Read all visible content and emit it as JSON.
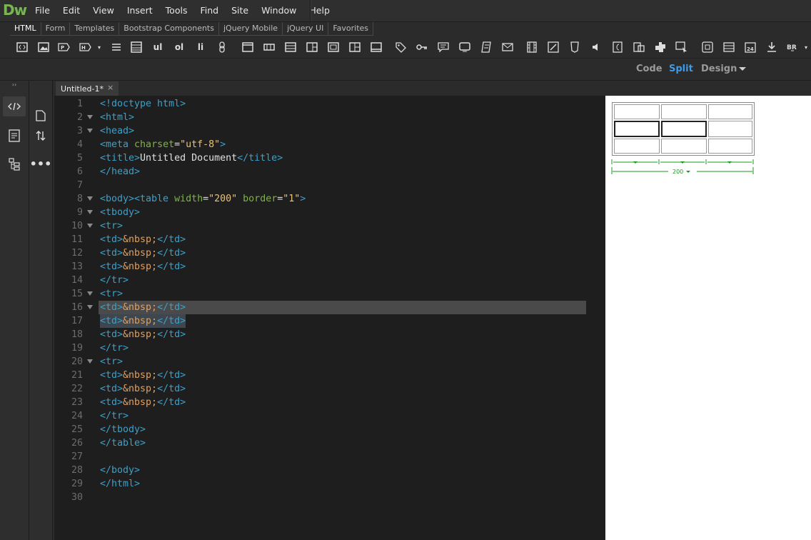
{
  "app": {
    "logo": "Dw"
  },
  "menu": [
    "File",
    "Edit",
    "View",
    "Insert",
    "Tools",
    "Find",
    "Site",
    "Window",
    "Help"
  ],
  "insert_tabs": [
    "HTML",
    "Form",
    "Templates",
    "Bootstrap Components",
    "jQuery Mobile",
    "jQuery UI",
    "Favorites"
  ],
  "toolbar": {
    "labels": {
      "ul": "ul",
      "ol": "ol",
      "li": "li"
    },
    "icons": [
      "div-icon",
      "image-icon",
      "paragraph-icon",
      "heading-icon",
      "list-icon",
      "table-icon",
      "ul-button",
      "ol-button",
      "li-button",
      "hyperlink-icon",
      "header-icon",
      "navigation-icon",
      "main-icon",
      "aside-icon",
      "article-icon",
      "section-icon",
      "footer-icon",
      "tag-icon",
      "key-icon",
      "comment-icon",
      "monitor-icon",
      "script-icon",
      "email-icon",
      "video-icon",
      "canvas-icon",
      "html5-icon",
      "audio-icon",
      "flash-icon",
      "plugin-icon",
      "rollover-image-icon",
      "iframe-icon",
      "horizontal-rule-icon",
      "date-icon",
      "download-icon",
      "character-icon"
    ]
  },
  "view": {
    "code": "Code",
    "split": "Split",
    "design": "Design",
    "active": "Split"
  },
  "document": {
    "tab_title": "Untitled-1*"
  },
  "code": {
    "lines": [
      {
        "n": "1",
        "segs": [
          [
            "t",
            "<!doctype html>"
          ]
        ]
      },
      {
        "n": "2",
        "fold": true,
        "segs": [
          [
            "t",
            "<html>"
          ]
        ]
      },
      {
        "n": "3",
        "fold": true,
        "segs": [
          [
            "t",
            "<head>"
          ]
        ]
      },
      {
        "n": "4",
        "segs": [
          [
            "t",
            "<meta "
          ],
          [
            "a",
            "charset"
          ],
          [
            "p",
            "="
          ],
          [
            "v",
            "\"utf-8\""
          ],
          [
            "t",
            ">"
          ]
        ]
      },
      {
        "n": "5",
        "segs": [
          [
            "t",
            "<title>"
          ],
          [
            "p",
            "Untitled Document"
          ],
          [
            "t",
            "</title>"
          ]
        ]
      },
      {
        "n": "6",
        "segs": [
          [
            "t",
            "</head>"
          ]
        ]
      },
      {
        "n": "7",
        "segs": []
      },
      {
        "n": "8",
        "fold": true,
        "segs": [
          [
            "t",
            "<body><table "
          ],
          [
            "a",
            "width"
          ],
          [
            "p",
            "="
          ],
          [
            "v",
            "\"200\""
          ],
          [
            "p",
            " "
          ],
          [
            "a",
            "border"
          ],
          [
            "p",
            "="
          ],
          [
            "v",
            "\"1\""
          ],
          [
            "t",
            ">"
          ]
        ]
      },
      {
        "n": "9",
        "fold": true,
        "segs": [
          [
            "t",
            "<tbody>"
          ]
        ]
      },
      {
        "n": "10",
        "fold": true,
        "segs": [
          [
            "t",
            "<tr>"
          ]
        ]
      },
      {
        "n": "11",
        "segs": [
          [
            "t",
            "<td>"
          ],
          [
            "e",
            "&nbsp;"
          ],
          [
            "t",
            "</td>"
          ]
        ]
      },
      {
        "n": "12",
        "segs": [
          [
            "t",
            "<td>"
          ],
          [
            "e",
            "&nbsp;"
          ],
          [
            "t",
            "</td>"
          ]
        ]
      },
      {
        "n": "13",
        "segs": [
          [
            "t",
            "<td>"
          ],
          [
            "e",
            "&nbsp;"
          ],
          [
            "t",
            "</td>"
          ]
        ]
      },
      {
        "n": "14",
        "segs": [
          [
            "t",
            "</tr>"
          ]
        ]
      },
      {
        "n": "15",
        "fold": true,
        "segs": [
          [
            "t",
            "<tr>"
          ]
        ]
      },
      {
        "n": "16",
        "fold": true,
        "hl": "row",
        "segs": [
          [
            "t",
            "<td>"
          ],
          [
            "e",
            "&nbsp;"
          ],
          [
            "t",
            "</td>"
          ]
        ]
      },
      {
        "n": "17",
        "hl": "sel",
        "segs": [
          [
            "t",
            "<td>"
          ],
          [
            "e",
            "&nbsp;"
          ],
          [
            "t",
            "</td>"
          ]
        ]
      },
      {
        "n": "18",
        "segs": [
          [
            "t",
            "<td>"
          ],
          [
            "e",
            "&nbsp;"
          ],
          [
            "t",
            "</td>"
          ]
        ]
      },
      {
        "n": "19",
        "segs": [
          [
            "t",
            "</tr>"
          ]
        ]
      },
      {
        "n": "20",
        "fold": true,
        "segs": [
          [
            "t",
            "<tr>"
          ]
        ]
      },
      {
        "n": "21",
        "segs": [
          [
            "t",
            "<td>"
          ],
          [
            "e",
            "&nbsp;"
          ],
          [
            "t",
            "</td>"
          ]
        ]
      },
      {
        "n": "22",
        "segs": [
          [
            "t",
            "<td>"
          ],
          [
            "e",
            "&nbsp;"
          ],
          [
            "t",
            "</td>"
          ]
        ]
      },
      {
        "n": "23",
        "segs": [
          [
            "t",
            "<td>"
          ],
          [
            "e",
            "&nbsp;"
          ],
          [
            "t",
            "</td>"
          ]
        ]
      },
      {
        "n": "24",
        "segs": [
          [
            "t",
            "</tr>"
          ]
        ]
      },
      {
        "n": "25",
        "segs": [
          [
            "t",
            "</tbody>"
          ]
        ]
      },
      {
        "n": "26",
        "segs": [
          [
            "t",
            "</table>"
          ]
        ]
      },
      {
        "n": "27",
        "segs": []
      },
      {
        "n": "28",
        "segs": [
          [
            "t",
            "</body>"
          ]
        ]
      },
      {
        "n": "29",
        "segs": [
          [
            "t",
            "</html>"
          ]
        ]
      },
      {
        "n": "30",
        "segs": []
      }
    ]
  },
  "design_view": {
    "table_width_label": "200"
  },
  "colors": {
    "tag": "#3ea0c8",
    "attr": "#7fb347",
    "value": "#e8c27d",
    "entity": "#e0a060",
    "accent": "#3d9be9",
    "logo": "#7ab554",
    "width_marker": "#1a9a1a"
  }
}
